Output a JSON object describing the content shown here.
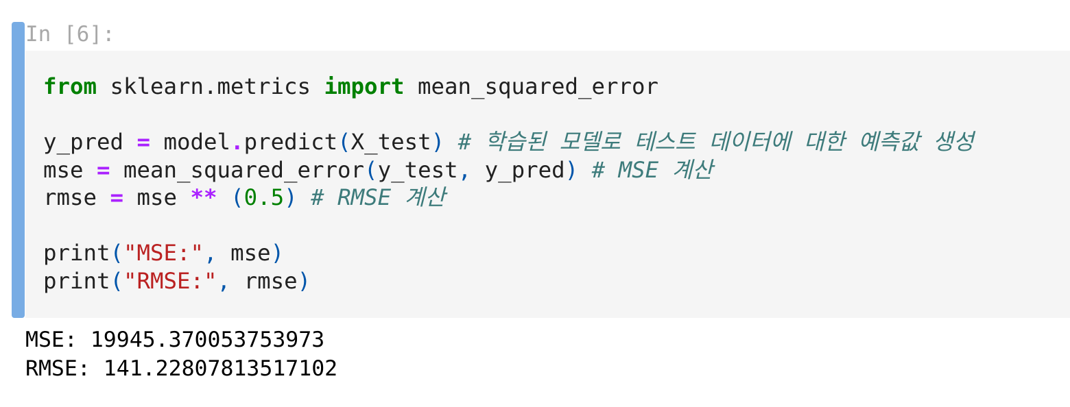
{
  "cell": {
    "prompt": "In [6]:",
    "accent_color": "#78ace4",
    "code_lines": [
      [
        [
          "kw",
          "from"
        ],
        [
          "t",
          " sklearn.metrics "
        ],
        [
          "kw",
          "import"
        ],
        [
          "t",
          " mean_squared_error"
        ]
      ],
      [],
      [
        [
          "t",
          "y_pred "
        ],
        [
          "op",
          "="
        ],
        [
          "t",
          " model"
        ],
        [
          "op",
          "."
        ],
        [
          "t",
          "predict"
        ],
        [
          "p",
          "("
        ],
        [
          "t",
          "X_test"
        ],
        [
          "p",
          ")"
        ],
        [
          "t",
          " "
        ],
        [
          "c",
          "# 학습된 모델로 테스트 데이터에 대한 예측값 생성"
        ]
      ],
      [
        [
          "t",
          "mse "
        ],
        [
          "op",
          "="
        ],
        [
          "t",
          " mean_squared_error"
        ],
        [
          "p",
          "("
        ],
        [
          "t",
          "y_test"
        ],
        [
          "p",
          ","
        ],
        [
          "t",
          " y_pred"
        ],
        [
          "p",
          ")"
        ],
        [
          "t",
          " "
        ],
        [
          "c",
          "# MSE 계산"
        ]
      ],
      [
        [
          "t",
          "rmse "
        ],
        [
          "op",
          "="
        ],
        [
          "t",
          " mse "
        ],
        [
          "op",
          "**"
        ],
        [
          "t",
          " "
        ],
        [
          "p",
          "("
        ],
        [
          "n",
          "0.5"
        ],
        [
          "p",
          ")"
        ],
        [
          "t",
          " "
        ],
        [
          "c",
          "# RMSE 계산"
        ]
      ],
      [],
      [
        [
          "t",
          "print"
        ],
        [
          "p",
          "("
        ],
        [
          "s",
          "\"MSE:\""
        ],
        [
          "p",
          ","
        ],
        [
          "t",
          " mse"
        ],
        [
          "p",
          ")"
        ]
      ],
      [
        [
          "t",
          "print"
        ],
        [
          "p",
          "("
        ],
        [
          "s",
          "\"RMSE:\""
        ],
        [
          "p",
          ","
        ],
        [
          "t",
          " rmse"
        ],
        [
          "p",
          ")"
        ]
      ]
    ],
    "output_lines": [
      "MSE: 19945.370053753973",
      "RMSE: 141.22807813517102"
    ]
  }
}
